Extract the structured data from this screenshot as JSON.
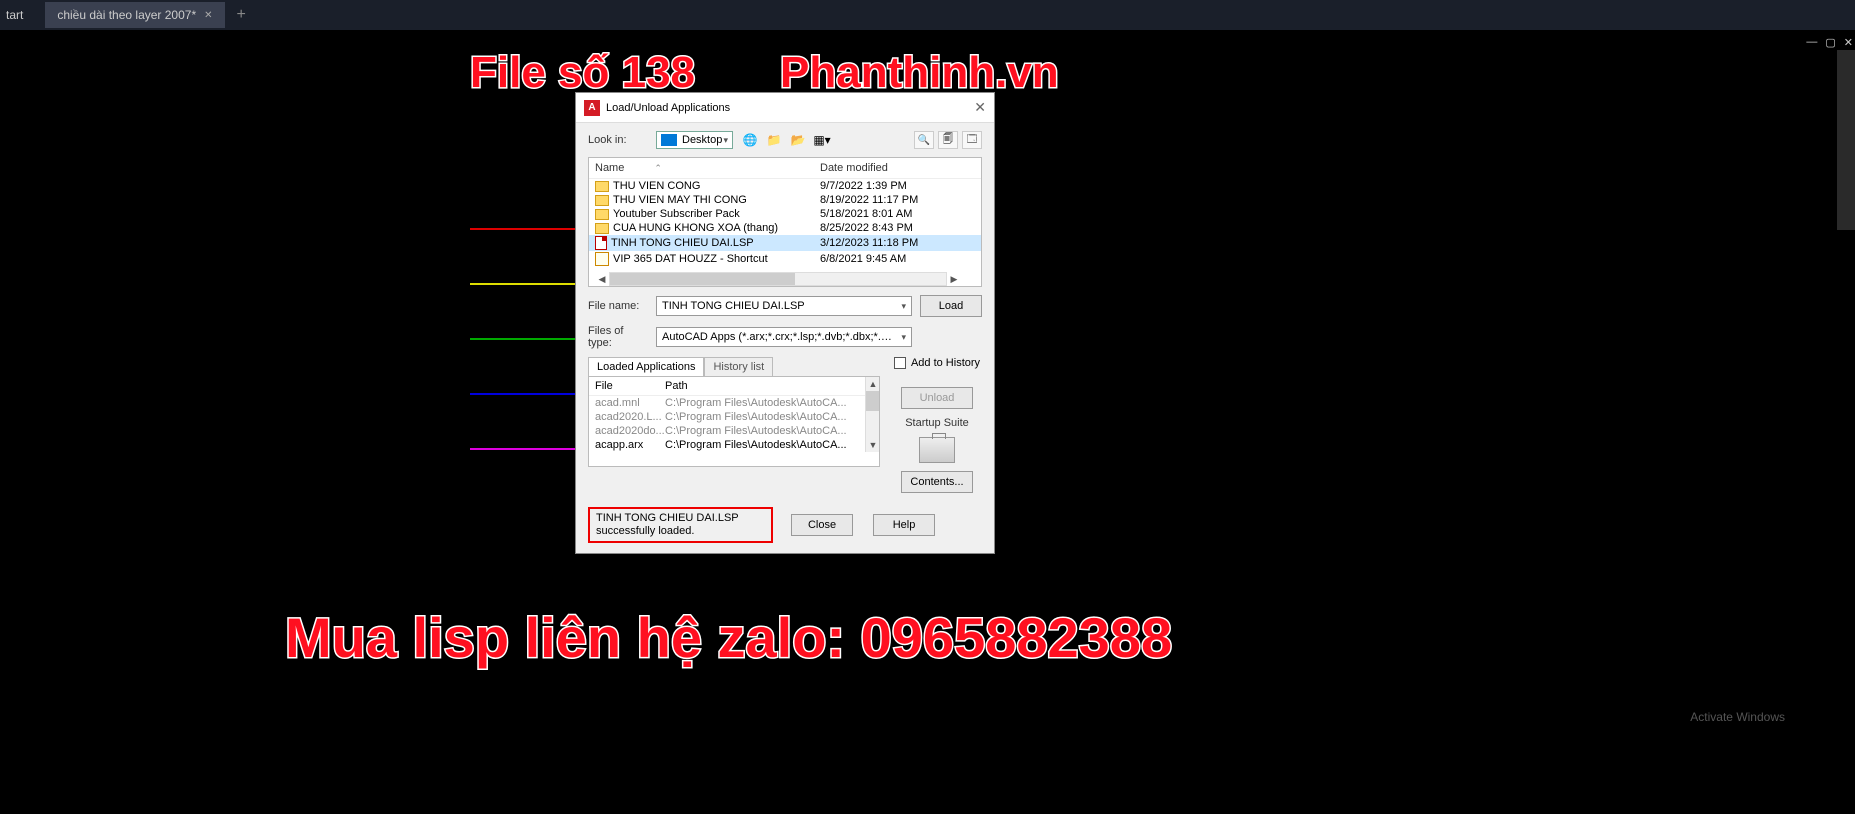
{
  "tabs": {
    "start": "tart",
    "file": "chiều dài theo layer 2007*"
  },
  "overlay": {
    "t1": "File số 138",
    "t2": "Phanthinh.vn",
    "t3": "Mua lisp liên hệ zalo: 0965882388"
  },
  "dialog": {
    "title": "Load/Unload Applications",
    "lookin_label": "Look in:",
    "lookin_value": "Desktop",
    "cols": {
      "name": "Name",
      "date": "Date modified"
    },
    "files": [
      {
        "name": "THU VIEN CONG",
        "date": "9/7/2022 1:39 PM",
        "type": "folder"
      },
      {
        "name": "THU VIEN MAY THI CONG",
        "date": "8/19/2022 11:17 PM",
        "type": "folder"
      },
      {
        "name": "Youtuber Subscriber Pack",
        "date": "5/18/2021 8:01 AM",
        "type": "folder"
      },
      {
        "name": "CUA HUNG KHONG XOA (thang)",
        "date": "8/25/2022 8:43 PM",
        "type": "folder"
      },
      {
        "name": "TINH TONG CHIEU DAI.LSP",
        "date": "3/12/2023 11:18 PM",
        "type": "file",
        "selected": true
      },
      {
        "name": "VIP 365 DAT HOUZZ - Shortcut",
        "date": "6/8/2021 9:45 AM",
        "type": "shortcut"
      }
    ],
    "filename_label": "File name:",
    "filename_value": "TINH TONG CHIEU DAI.LSP",
    "filetype_label": "Files of type:",
    "filetype_value": "AutoCAD Apps (*.arx;*.crx;*.lsp;*.dvb;*.dbx;*.…",
    "load_btn": "Load",
    "tab_loaded": "Loaded Applications",
    "tab_history": "History list",
    "chk_history": "Add to History",
    "loaded_cols": {
      "file": "File",
      "path": "Path"
    },
    "loaded": [
      {
        "file": "acad.mnl",
        "path": "C:\\Program Files\\Autodesk\\AutoCA..."
      },
      {
        "file": "acad2020.L...",
        "path": "C:\\Program Files\\Autodesk\\AutoCA..."
      },
      {
        "file": "acad2020do...",
        "path": "C:\\Program Files\\Autodesk\\AutoCA..."
      },
      {
        "file": "acapp.arx",
        "path": "C:\\Program Files\\Autodesk\\AutoCA..."
      }
    ],
    "unload_btn": "Unload",
    "suite_label": "Startup Suite",
    "contents_btn": "Contents...",
    "status": "TINH TONG CHIEU DAI.LSP successfully loaded.",
    "close_btn": "Close",
    "help_btn": "Help"
  },
  "watermark": "Activate Windows"
}
